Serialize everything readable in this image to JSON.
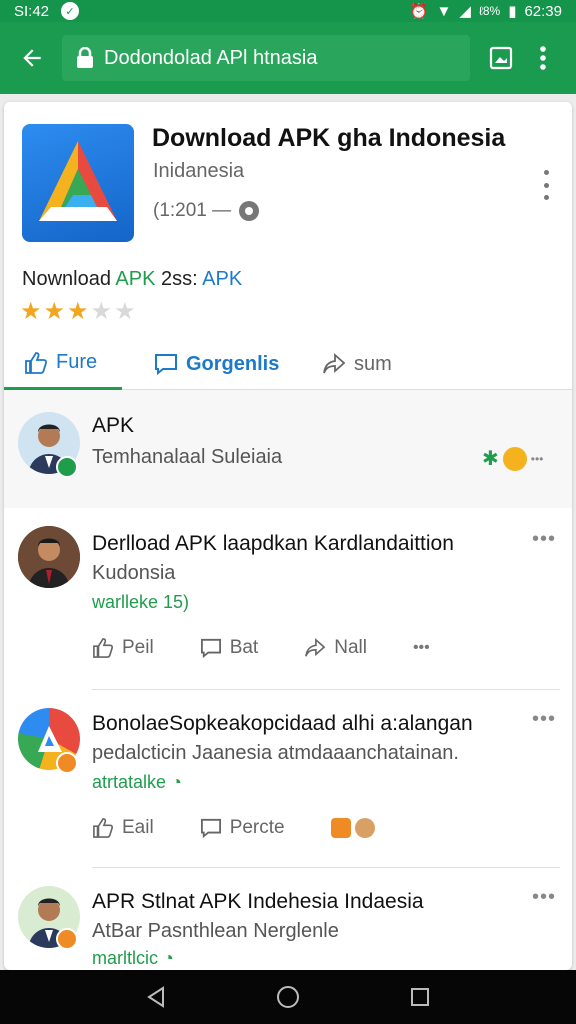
{
  "status_bar": {
    "time_left": "SI:42",
    "battery_text": "ℓ8%",
    "time_right": "62:39"
  },
  "browser": {
    "url_text": "Dodondolad APl htnasia"
  },
  "app": {
    "title": "Download APK gha Indonesia",
    "subtitle": "Inidanesia",
    "meta": "(1:201 —",
    "promo_prefix": "Nownload ",
    "promo_green": "APK",
    "promo_mid": " 2ss: ",
    "promo_blue": "APK",
    "rating": 3,
    "max_rating": 5
  },
  "tabs": [
    {
      "label": "Fure"
    },
    {
      "label": "Gorgenlis"
    },
    {
      "label": "sum"
    }
  ],
  "feed": [
    {
      "title": "APK",
      "subtitle": "Temhanalaal Suleiaia"
    },
    {
      "title": "Derlload APK laapdkan Kardlandaittion",
      "subtitle": "Kudonsia",
      "link": "warlleke 15)",
      "actions": [
        "Peil",
        "Bat",
        "Nall"
      ]
    },
    {
      "title": "BonolaeSopkeakopcidaad alhi a:alangan",
      "subtitle": "pedalcticin Jaanesia atmdaaanchatainan.",
      "link": "atrtatalke",
      "actions": [
        "Eail",
        "Percte"
      ]
    },
    {
      "title": "APR Stlnat APK Indehesia Indaesia",
      "subtitle": "AtBar Pasnthlean Nerglenle",
      "link": "marltlcic"
    }
  ],
  "colors": {
    "green": "#1b9b4f",
    "blue": "#1d7ac8",
    "star": "#f2a51f"
  }
}
